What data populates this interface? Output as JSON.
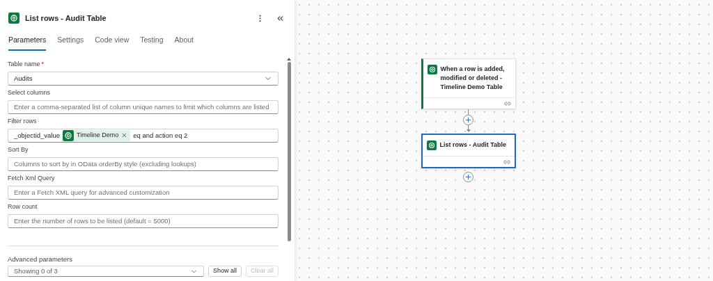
{
  "panel": {
    "title": "List rows - Audit Table"
  },
  "tabs": [
    {
      "label": "Parameters",
      "selected": true
    },
    {
      "label": "Settings",
      "selected": false
    },
    {
      "label": "Code view",
      "selected": false
    },
    {
      "label": "Testing",
      "selected": false
    },
    {
      "label": "About",
      "selected": false
    }
  ],
  "fields": [
    {
      "kind": "dropdown",
      "label": "Table name",
      "required_mark": "*",
      "value": "Audits"
    },
    {
      "kind": "text",
      "label": "Select columns",
      "placeholder": "Enter a comma-separated list of column unique names to limit which columns are listed"
    },
    {
      "kind": "filter",
      "label": "Filter rows",
      "before": "_objectid_value",
      "token": "Timeline Demo",
      "after": "eq and action eq 2"
    },
    {
      "kind": "text",
      "label": "Sort By",
      "placeholder": "Columns to sort by in OData orderBy style (excluding lookups)"
    },
    {
      "kind": "text",
      "label": "Fetch Xml Query",
      "placeholder": "Enter a Fetch XML query for advanced customization"
    },
    {
      "kind": "text",
      "label": "Row count",
      "placeholder": "Enter the number of rows to be listed (default = 5000)"
    }
  ],
  "advanced": {
    "label": "Advanced parameters",
    "value": "Showing 0 of 3",
    "show_all": {
      "label": "Show all",
      "disabled": false
    },
    "clear_all": {
      "label": "Clear all",
      "disabled": true
    }
  },
  "flow": [
    {
      "kind": "trigger",
      "title": "When a row is added, modified or deleted - Timeline Demo Table",
      "selected": false
    },
    {
      "kind": "action",
      "title": "List rows - Audit Table",
      "selected": true
    }
  ]
}
